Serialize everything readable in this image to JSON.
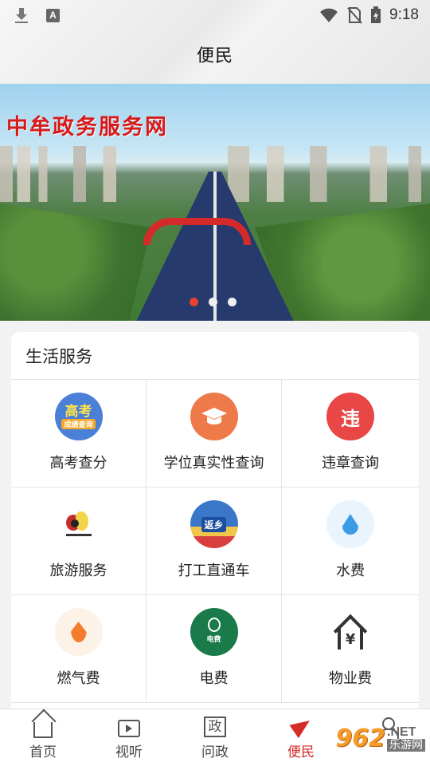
{
  "status_bar": {
    "time": "9:18",
    "icons": [
      "download-icon",
      "a-notification-icon",
      "wifi-icon",
      "no-sim-icon",
      "battery-charging-icon"
    ]
  },
  "header": {
    "title": "便民"
  },
  "banner": {
    "text": "中牟政务服务网",
    "dots": 3,
    "active_dot": 1
  },
  "life_services": {
    "title": "生活服务",
    "items": [
      {
        "label": "高考查分",
        "icon": "gaokao-score-icon",
        "icon_text": "高考",
        "icon_subtext": "成绩查询"
      },
      {
        "label": "学位真实性查询",
        "icon": "graduation-cap-icon"
      },
      {
        "label": "违章查询",
        "icon": "traffic-violation-icon",
        "icon_text": "违"
      },
      {
        "label": "旅游服务",
        "icon": "travel-mascot-icon"
      },
      {
        "label": "打工直通车",
        "icon": "migrant-bus-icon",
        "icon_text": "返乡"
      },
      {
        "label": "水费",
        "icon": "water-drop-icon"
      },
      {
        "label": "燃气费",
        "icon": "gas-flame-icon"
      },
      {
        "label": "电费",
        "icon": "lightbulb-icon",
        "icon_text": "电费"
      },
      {
        "label": "物业费",
        "icon": "house-yen-icon",
        "icon_text": "¥"
      }
    ]
  },
  "bottom_nav": {
    "tabs": [
      {
        "label": "首页",
        "icon": "home-icon",
        "active": false
      },
      {
        "label": "视听",
        "icon": "tv-play-icon",
        "active": false
      },
      {
        "label": "问政",
        "icon": "zheng-icon",
        "active": false,
        "icon_text": "政"
      },
      {
        "label": "便民",
        "icon": "paper-plane-icon",
        "active": true
      }
    ]
  },
  "watermark": {
    "logo": "962",
    "net": ".NET",
    "cn": "乐游网"
  },
  "colors": {
    "accent": "#d42a2a",
    "dot_active": "#e5432d"
  }
}
